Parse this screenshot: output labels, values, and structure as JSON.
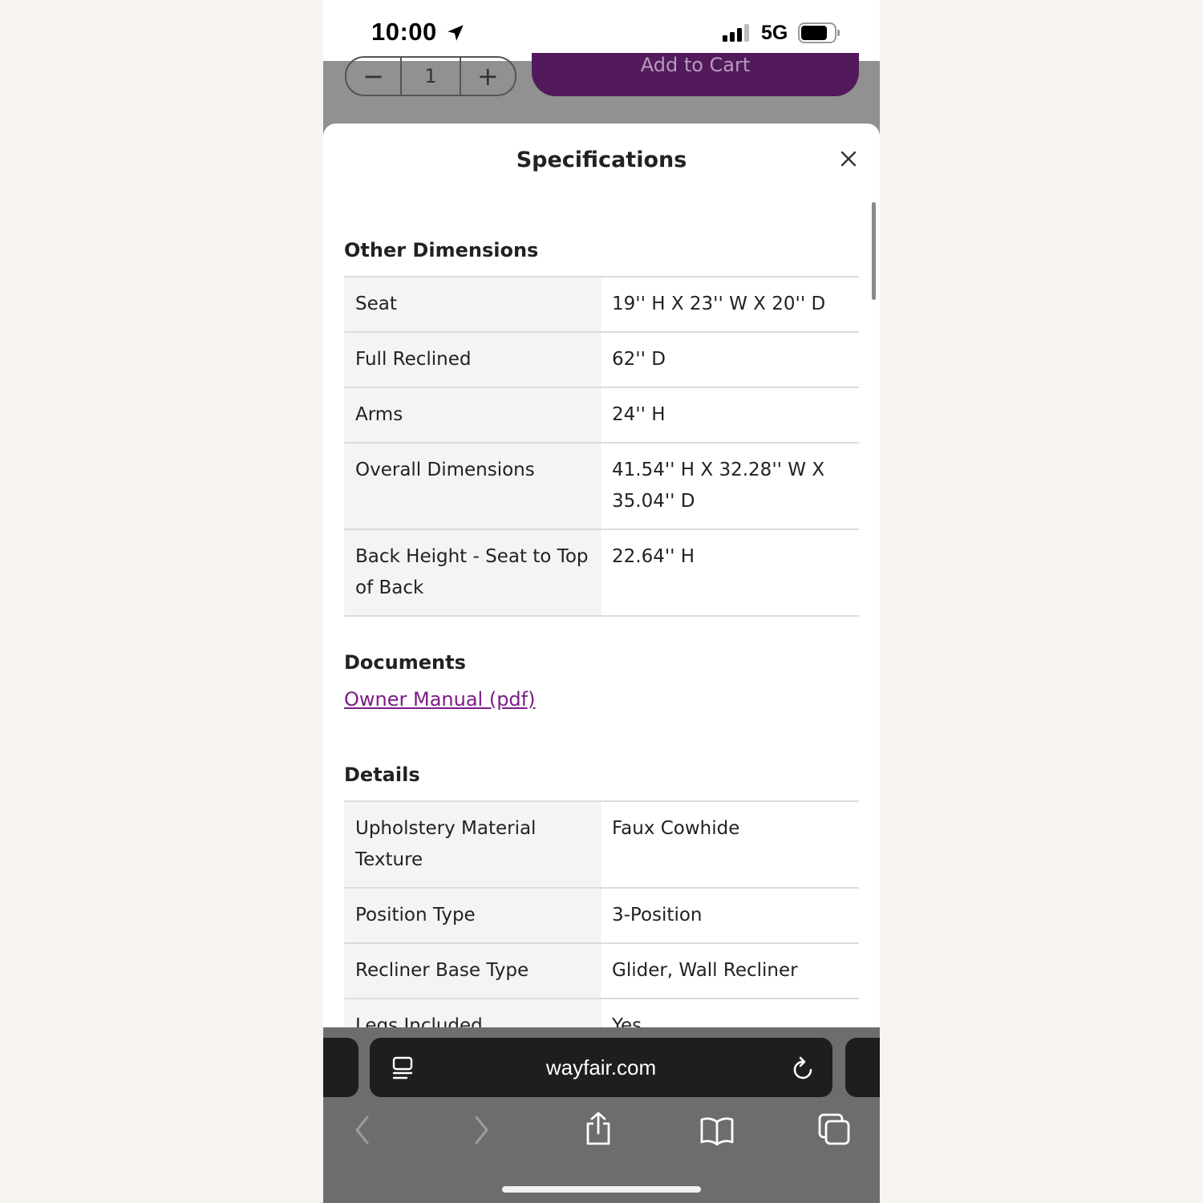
{
  "status_bar": {
    "time": "10:00",
    "network": "5G"
  },
  "cart": {
    "quantity": "1",
    "add_label": "Add to Cart",
    "minus": "−",
    "plus": "+"
  },
  "sheet": {
    "title": "Specifications",
    "other_dimensions": {
      "heading": "Other Dimensions",
      "rows": [
        {
          "label": "Seat",
          "value": "19'' H X 23'' W X 20'' D"
        },
        {
          "label": "Full Reclined",
          "value": "62'' D"
        },
        {
          "label": "Arms",
          "value": "24'' H"
        },
        {
          "label": "Overall Dimensions",
          "value": "41.54'' H X 32.28'' W X 35.04'' D"
        },
        {
          "label": "Back Height - Seat to Top of Back",
          "value": "22.64'' H"
        }
      ]
    },
    "documents": {
      "heading": "Documents",
      "link": "Owner Manual (pdf)"
    },
    "details": {
      "heading": "Details",
      "rows": [
        {
          "label": "Upholstery Material Texture",
          "value": "Faux Cowhide"
        },
        {
          "label": "Position Type",
          "value": "3-Position"
        },
        {
          "label": "Recliner Base Type",
          "value": "Glider, Wall Recliner"
        },
        {
          "label": "Legs Included",
          "value": "Yes"
        }
      ]
    }
  },
  "browser": {
    "url": "wayfair.com"
  },
  "colors": {
    "accent": "#521a5c",
    "link": "#7b1e86"
  }
}
